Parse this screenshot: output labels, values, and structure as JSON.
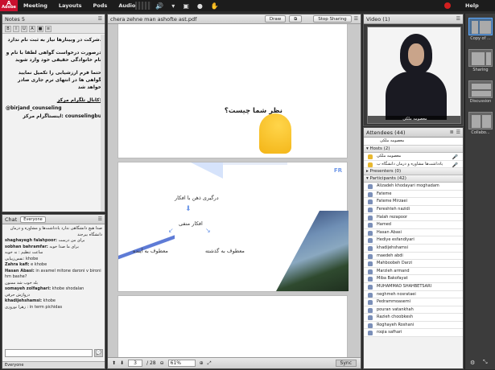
{
  "menubar": {
    "logo_line1": "Adobe",
    "items": [
      "Meeting",
      "Layouts",
      "Pods",
      "Audio"
    ],
    "help": "Help"
  },
  "notes": {
    "title": "Notes",
    "count": "5",
    "lines": [
      ".شرکت در وبینارها نیاز به ثبت نام ندارد",
      "درصورت درخواست گواهی لطفا با نام و نام خانوادگی حقیقی خود وارد شوید",
      "حتما فرم ارزشیابی را تکمیل نمایید گواهی ها در انتهای ترم جاری صادر خواهد شد",
      ":کانال تلگرام مرکز",
      "@birjand_counseling",
      "counselingbu  :اینستاگرام مرکز"
    ]
  },
  "chat": {
    "title": "Chat",
    "scope": "Everyone",
    "messages": [
      {
        "name": "",
        "text": "صدا هیچ دانشگاهی ندارد یادداشت‌ها و مشاوره و درمان دانشگاه بیرجند"
      },
      {
        "name": "shaghayegh falahpoor:",
        "text": "برای من درست"
      },
      {
        "name": "sobhan bahramfar:",
        "text": "برای ما صدا خوبه"
      },
      {
        "name": "",
        "text": "ساعت تنظیم : نه خوبه"
      },
      {
        "name": "",
        "text": "نفس‌زیبایی: khobe"
      },
      {
        "name": "Zahra kafi:",
        "text": "e khobe"
      },
      {
        "name": "Hasan Abasi:",
        "text": "in avamel mitone daroni v bironi hm bashe?"
      },
      {
        "name": "",
        "text": "بله خوب شد ممنون"
      },
      {
        "name": "somayeh zolfaghari:",
        "text": "khobe shodalan"
      },
      {
        "name": "",
        "text": "درواژش حرفی"
      },
      {
        "name": "khadijehshamsi:",
        "text": "khobe"
      },
      {
        "name": "",
        "text": "زهرا نوروزی : in term pichidas"
      }
    ],
    "footer": "Everyone"
  },
  "share": {
    "title": "chera zehne man ashofte ast.pdf",
    "draw": "Draw",
    "stop": "Stop Sharing",
    "slide1_title": "نظر شما چیست؟",
    "slide2": {
      "logo": "FR",
      "top": "درگیری ذهن با افکار",
      "mid": "افکار منفی",
      "left": "معطوف به آینده",
      "right": "معطوف به گذشته"
    },
    "page": "3",
    "total": "/ 28",
    "zoom": "61%",
    "sync": "Sync"
  },
  "video": {
    "title": "Video",
    "count": "(1)",
    "label": "معصومه ملکی"
  },
  "attendees": {
    "title": "Attendees",
    "count": "(44)",
    "me": "معصومه ملکی",
    "hosts_label": "Hosts (2)",
    "hosts": [
      "معصومه ملکی",
      "یادداشت‌ها مشاوره و درمان دانشگاه ب"
    ],
    "presenters_label": "Presenters (0)",
    "participants_label": "Participants (42)",
    "participants": [
      "Alizadeh khodayari moghadam",
      "Fateme",
      "Fateme Mirzaei",
      "Fereshteh nazidi",
      "Halah rezapoor",
      "Hamed",
      "Hasan Abasi",
      "Hediye esfandiyari",
      "khadijehshamsi",
      "maedeh abdi",
      "Mahboobeh Darzi",
      "Marzieh armand",
      "Miba Bakofayat",
      "MUHAMMAD SHAHBETSARI",
      "neghmeh nosrataei",
      "Pedrammoasemi",
      "pouran vatankhah",
      "Razieh choobkesh",
      "Roghayeh Roshani",
      "roqia safhari"
    ]
  },
  "rail": {
    "layouts": [
      "Copy of ...",
      "Sharing",
      "Discussion",
      "Collabo..."
    ]
  }
}
